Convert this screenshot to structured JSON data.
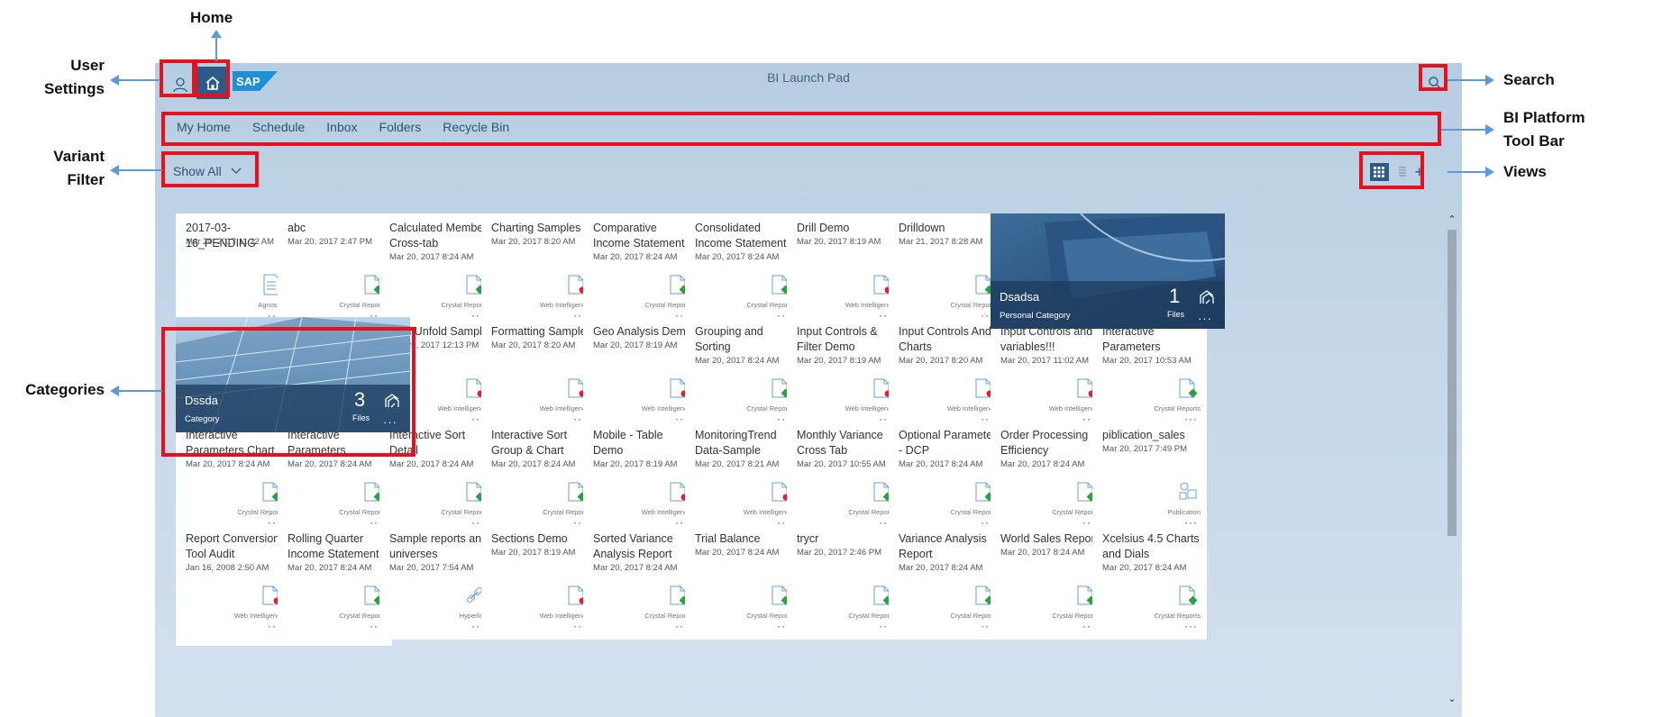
{
  "shell": {
    "title": "BI Launch Pad",
    "logo_text": "SAP"
  },
  "toolbar": {
    "items": [
      "My Home",
      "Schedule",
      "Inbox",
      "Folders",
      "Recycle Bin"
    ]
  },
  "variant_filter": {
    "label": "Show All"
  },
  "views": {
    "add_label": "+"
  },
  "callouts": {
    "home": "Home",
    "user_settings": [
      "User",
      "Settings"
    ],
    "variant_filter": [
      "Variant",
      "Filter"
    ],
    "categories": "Categories",
    "search": "Search",
    "toolbar": [
      "BI Platform",
      "Tool Bar"
    ],
    "views": "Views"
  },
  "colors": {
    "highlight": "#e8101a",
    "accent": "#2d5a87",
    "arrow": "#5b9bd5"
  },
  "tiles": [
    {
      "title": "2017-03-16_PENDING",
      "date": "Mar 20, 2017 11:22 AM",
      "type": "Agnostic",
      "icon": "document-icon"
    },
    {
      "title": "abc",
      "date": "Mar 20, 2017 2:47 PM",
      "type": "Crystal Reports",
      "icon": "crystal-report-icon"
    },
    {
      "title": "Calculated Member Cross-tab",
      "date": "Mar 20, 2017 8:24 AM",
      "type": "Crystal Reports",
      "icon": "crystal-report-icon"
    },
    {
      "title": "Charting Samples",
      "date": "Mar 20, 2017 8:20 AM",
      "type": "Web Intelligence",
      "icon": "webi-icon"
    },
    {
      "title": "Comparative Income Statement",
      "date": "Mar 20, 2017 8:24 AM",
      "type": "Crystal Reports",
      "icon": "crystal-report-icon"
    },
    {
      "title": "Consolidated Income Statement",
      "date": "Mar 20, 2017 8:24 AM",
      "type": "Crystal Reports",
      "icon": "crystal-report-icon"
    },
    {
      "title": "Drill Demo",
      "date": "Mar 20, 2017 8:19 AM",
      "type": "Web Intelligence",
      "icon": "webi-icon"
    },
    {
      "title": "Drilldown",
      "date": "Mar 21, 2017 8:28 AM",
      "type": "Crystal Reports",
      "icon": "crystal-report-icon"
    },
    {
      "title": "Fold Unfold Sample",
      "date": "Mar 20, 2017 12:13 PM",
      "type": "Web Intelligence",
      "icon": "webi-icon"
    },
    {
      "title": "Formatting Sample",
      "date": "Mar 20, 2017 8:20 AM",
      "type": "Web Intelligence",
      "icon": "webi-icon"
    },
    {
      "title": "Geo Analysis Demo",
      "date": "Mar 20, 2017 8:19 AM",
      "type": "Web Intelligence",
      "icon": "webi-icon"
    },
    {
      "title": "Grouping and Sorting",
      "date": "Mar 20, 2017 8:24 AM",
      "type": "Crystal Reports",
      "icon": "crystal-report-icon"
    },
    {
      "title": "Input Controls & Filter Demo",
      "date": "Mar 20, 2017 8:19 AM",
      "type": "Web Intelligence",
      "icon": "webi-icon"
    },
    {
      "title": "Input Controls And Charts",
      "date": "Mar 20, 2017 8:20 AM",
      "type": "Web Intelligence",
      "icon": "webi-icon"
    },
    {
      "title": "Input Controls and variables!!!",
      "date": "Mar 20, 2017 11:02 AM",
      "type": "Web Intelligence",
      "icon": "webi-icon"
    },
    {
      "title": "Interactive Parameters",
      "date": "Mar 20, 2017 10:53 AM",
      "type": "Crystal Reports",
      "icon": "crystal-report-icon"
    },
    {
      "title": "Interactive Parameters Chart",
      "date": "Mar 20, 2017 8:24 AM",
      "type": "Crystal Reports",
      "icon": "crystal-report-icon"
    },
    {
      "title": "Interactive Parameters",
      "date": "Mar 20, 2017 8:24 AM",
      "type": "Crystal Reports",
      "icon": "crystal-report-icon"
    },
    {
      "title": "Interactive Sort Detail",
      "date": "Mar 20, 2017 8:24 AM",
      "type": "Crystal Reports",
      "icon": "crystal-report-icon"
    },
    {
      "title": "Interactive Sort Group & Chart",
      "date": "Mar 20, 2017 8:24 AM",
      "type": "Crystal Reports",
      "icon": "crystal-report-icon"
    },
    {
      "title": "Mobile - Table Demo",
      "date": "Mar 20, 2017 8:19 AM",
      "type": "Web Intelligence",
      "icon": "webi-icon"
    },
    {
      "title": "MonitoringTrend Data-Sample",
      "date": "Mar 20, 2017 8:21 AM",
      "type": "Web Intelligence",
      "icon": "webi-icon"
    },
    {
      "title": "Monthly Variance Cross Tab",
      "date": "Mar 20, 2017 10:55 AM",
      "type": "Crystal Reports",
      "icon": "crystal-report-icon"
    },
    {
      "title": "Optional Parameter - DCP",
      "date": "Mar 20, 2017 8:24 AM",
      "type": "Crystal Reports",
      "icon": "crystal-report-icon"
    },
    {
      "title": "Order Processing Efficiency",
      "date": "Mar 20, 2017 8:24 AM",
      "type": "Crystal Reports",
      "icon": "crystal-report-icon"
    },
    {
      "title": "piblication_sales",
      "date": "Mar 20, 2017 7:49 PM",
      "type": "Publication",
      "icon": "publication-icon"
    },
    {
      "title": "Report Conversion Tool Audit",
      "date": "Jan 16, 2008 2:50 AM",
      "type": "Web Intelligence",
      "icon": "webi-icon"
    },
    {
      "title": "Rolling Quarter Income Statement",
      "date": "Mar 20, 2017 8:24 AM",
      "type": "Crystal Reports",
      "icon": "crystal-report-icon"
    },
    {
      "title": "Sample reports and universes",
      "date": "Mar 20, 2017 7:54 AM",
      "type": "Hyperlink",
      "icon": "hyperlink-icon"
    },
    {
      "title": "Sections Demo",
      "date": "Mar 20, 2017 8:19 AM",
      "type": "Web Intelligence",
      "icon": "webi-icon"
    },
    {
      "title": "Sorted Variance Analysis Report",
      "date": "Mar 20, 2017 8:24 AM",
      "type": "Crystal Reports",
      "icon": "crystal-report-icon"
    },
    {
      "title": "Trial Balance",
      "date": "Mar 20, 2017 8:24 AM",
      "type": "Crystal Reports",
      "icon": "crystal-report-icon"
    },
    {
      "title": "trycr",
      "date": "Mar 20, 2017 2:46 PM",
      "type": "Crystal Reports",
      "icon": "crystal-report-icon"
    },
    {
      "title": "Variance Analysis Report",
      "date": "Mar 20, 2017 8:24 AM",
      "type": "Crystal Reports",
      "icon": "crystal-report-icon"
    },
    {
      "title": "World Sales Report",
      "date": "Mar 20, 2017 8:24 AM",
      "type": "Crystal Reports",
      "icon": "crystal-report-icon"
    },
    {
      "title": "Xcelsius 4.5 Charts and Dials",
      "date": "Mar 20, 2017 8:24 AM",
      "type": "Crystal Reports",
      "icon": "crystal-report-icon"
    }
  ],
  "categories": [
    {
      "name": "Dsadsa",
      "sub": "Personal Category",
      "count": "1",
      "files_label": "Files",
      "image": "notebook-image"
    },
    {
      "name": "Dssda",
      "sub": "Category",
      "count": "3",
      "files_label": "Files",
      "image": "building-image"
    }
  ]
}
